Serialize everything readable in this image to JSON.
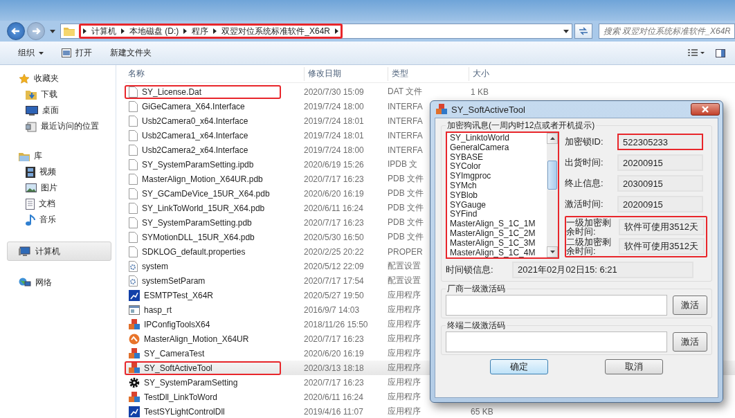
{
  "address": {
    "highlighted": true,
    "crumbs": [
      "计算机",
      "本地磁盘 (D:)",
      "程序",
      "双翌对位系统标准软件_X64R"
    ]
  },
  "search": {
    "placeholder": "搜索 双翌对位系统标准软件_X64R"
  },
  "toolbar": [
    {
      "label": "组织",
      "kind": "menu"
    },
    {
      "label": "打开",
      "kind": "open"
    },
    {
      "label": "新建文件夹",
      "kind": "plain"
    }
  ],
  "nav": [
    {
      "label": "收藏夹",
      "kind": "favorites",
      "selected": false,
      "children": [
        {
          "label": "下载",
          "kind": "downloads",
          "selected": false
        },
        {
          "label": "桌面",
          "kind": "desktop",
          "selected": false
        },
        {
          "label": "最近访问的位置",
          "kind": "recent",
          "selected": false
        }
      ]
    },
    {
      "label": "库",
      "kind": "library",
      "selected": false,
      "children": [
        {
          "label": "视频",
          "kind": "video",
          "selected": false
        },
        {
          "label": "图片",
          "kind": "image",
          "selected": false
        },
        {
          "label": "文档",
          "kind": "document",
          "selected": false
        },
        {
          "label": "音乐",
          "kind": "music",
          "selected": false
        }
      ]
    },
    {
      "label": "计算机",
      "kind": "computer",
      "selected": true
    },
    {
      "label": "网络",
      "kind": "network",
      "selected": false
    }
  ],
  "columns": [
    "名称",
    "修改日期",
    "类型",
    "大小"
  ],
  "files": [
    {
      "name": "SY_License.Dat",
      "date": "2020/7/30 15:09",
      "type": "DAT 文件",
      "size": "1 KB",
      "kind": "document",
      "selected": false,
      "highlighted": true
    },
    {
      "name": "GiGeCamera_X64.Interface",
      "date": "2019/7/24 18:00",
      "type": "INTERFA",
      "kind": "document",
      "selected": false,
      "highlighted": false
    },
    {
      "name": "Usb2Camera0_x64.Interface",
      "date": "2019/7/24 18:01",
      "type": "INTERFA",
      "kind": "document",
      "selected": false,
      "highlighted": false
    },
    {
      "name": "Usb2Camera1_x64.Interface",
      "date": "2019/7/24 18:01",
      "type": "INTERFA",
      "kind": "document",
      "selected": false,
      "highlighted": false
    },
    {
      "name": "Usb2Camera2_x64.Interface",
      "date": "2019/7/24 18:00",
      "type": "INTERFA",
      "kind": "document",
      "selected": false,
      "highlighted": false
    },
    {
      "name": "SY_SystemParamSetting.ipdb",
      "date": "2020/6/19 15:26",
      "type": "IPDB 文",
      "kind": "document",
      "selected": false,
      "highlighted": false
    },
    {
      "name": "MasterAlign_Motion_X64UR.pdb",
      "date": "2020/7/17 16:23",
      "type": "PDB 文件",
      "kind": "document",
      "selected": false,
      "highlighted": false
    },
    {
      "name": "SY_GCamDeVice_15UR_X64.pdb",
      "date": "2020/6/20 16:19",
      "type": "PDB 文件",
      "kind": "document",
      "selected": false,
      "highlighted": false
    },
    {
      "name": "SY_LinkToWorld_15UR_X64.pdb",
      "date": "2020/6/11 16:24",
      "type": "PDB 文件",
      "kind": "document",
      "selected": false,
      "highlighted": false
    },
    {
      "name": "SY_SystemParamSetting.pdb",
      "date": "2020/7/17 16:23",
      "type": "PDB 文件",
      "kind": "document",
      "selected": false,
      "highlighted": false
    },
    {
      "name": "SYMotionDLL_15UR_X64.pdb",
      "date": "2020/5/30 16:50",
      "type": "PDB 文件",
      "kind": "document",
      "selected": false,
      "highlighted": false
    },
    {
      "name": "SDKLOG_default.properties",
      "date": "2020/2/25 20:22",
      "type": "PROPER",
      "kind": "document",
      "selected": false,
      "highlighted": false
    },
    {
      "name": "system",
      "date": "2020/5/12 22:09",
      "type": "配置设置",
      "kind": "config",
      "selected": false,
      "highlighted": false
    },
    {
      "name": "systemSetParam",
      "date": "2020/7/17 17:54",
      "type": "配置设置",
      "kind": "config",
      "selected": false,
      "highlighted": false
    },
    {
      "name": "ESMTPTest_X64R",
      "date": "2020/5/27 19:50",
      "type": "应用程序",
      "kind": "chart-app",
      "selected": false,
      "highlighted": false
    },
    {
      "name": "hasp_rt",
      "date": "2016/9/7 14:03",
      "type": "应用程序",
      "kind": "window-app",
      "selected": false,
      "highlighted": false
    },
    {
      "name": "IPConfigToolsX64",
      "date": "2018/11/26 15:50",
      "type": "应用程序",
      "kind": "cubes-app",
      "selected": false,
      "highlighted": false
    },
    {
      "name": "MasterAlign_Motion_X64UR",
      "date": "2020/7/17 16:23",
      "type": "应用程序",
      "kind": "round-app",
      "selected": false,
      "highlighted": false
    },
    {
      "name": "SY_CameraTest",
      "date": "2020/6/20 16:19",
      "type": "应用程序",
      "kind": "cubes-app",
      "selected": false,
      "highlighted": false
    },
    {
      "name": "SY_SoftActiveTool",
      "date": "2020/3/13 18:18",
      "type": "应用程序",
      "kind": "cubes-app",
      "selected": true,
      "highlighted": true
    },
    {
      "name": "SY_SystemParamSetting",
      "date": "2020/7/17 16:23",
      "type": "应用程序",
      "kind": "gear-app",
      "selected": false,
      "highlighted": false
    },
    {
      "name": "TestDll_LinkToWord",
      "date": "2020/6/11 16:24",
      "type": "应用程序",
      "kind": "cubes-app",
      "selected": false,
      "highlighted": false
    },
    {
      "name": "TestSYLightControlDll",
      "date": "2019/4/16 11:07",
      "type": "应用程序",
      "size": "65 KB",
      "kind": "chart-app",
      "selected": false,
      "highlighted": false
    }
  ],
  "dialog": {
    "title": "SY_SoftActiveTool",
    "group_title": "加密狗讯息(一周内时12点或者开机提示)",
    "modules": {
      "highlighted": true,
      "items": [
        "SY_LinktoWorld",
        "GeneralCamera",
        "SYBASE",
        "SYColor",
        "SYImgproc",
        "SYMch",
        "SYBlob",
        "SYGauge",
        "SYFind",
        "MasterAlign_S_1C_1M",
        "MasterAlign_S_1C_2M",
        "MasterAlign_S_1C_3M",
        "MasterAlign_S_1C_4M"
      ]
    },
    "fields": [
      {
        "label": "加密锁ID:",
        "value": "522305233",
        "highlighted": true
      },
      {
        "label": "出货时间:",
        "value": "20200915",
        "highlighted": false
      },
      {
        "label": "终止信息:",
        "value": "20300915",
        "highlighted": false
      },
      {
        "label": "激活时间:",
        "value": "20200915",
        "highlighted": false
      }
    ],
    "remaining": {
      "highlighted": true,
      "rows": [
        {
          "label": "一级加密剩余时间:",
          "value": "软件可使用3512天"
        },
        {
          "label": "二级加密剩余时间:",
          "value": "软件可使用3512天"
        }
      ]
    },
    "time_lock": {
      "label": "时间锁信息:",
      "value": "2021年02月02日15: 6:21"
    },
    "activations": [
      {
        "title": "厂商一级激活码",
        "button": "激活"
      },
      {
        "title": "终端二级激活码",
        "button": "激活"
      }
    ],
    "buttons": [
      {
        "label": "确定",
        "default": true
      },
      {
        "label": "取消",
        "default": false
      }
    ]
  }
}
